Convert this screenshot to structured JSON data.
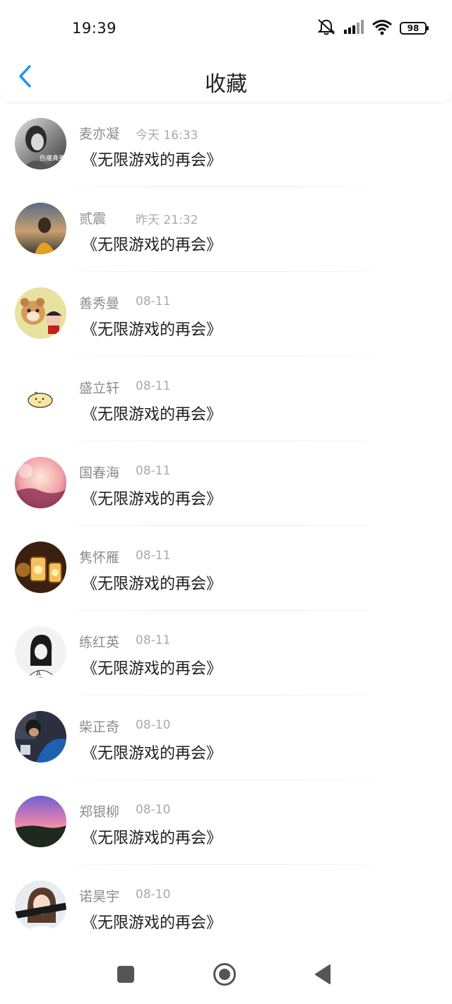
{
  "status_bar": {
    "time": "19:39",
    "icons": [
      "mute-bell-icon",
      "signal-icon",
      "wifi-icon"
    ],
    "battery_level": "98"
  },
  "nav": {
    "back_icon": "chevron-left-icon",
    "title": "收藏",
    "accent_color": "#2196F3"
  },
  "items": [
    {
      "name": "麦亦凝",
      "time": "今天 16:33",
      "title": "《无限游戏的再会》",
      "avatar_icon": "girl-photo-avatar",
      "avatar_text": "伤痛真美"
    },
    {
      "name": "贰震",
      "time": "昨天 21:32",
      "title": "《无限游戏的再会》",
      "avatar_icon": "sunset-girl-avatar"
    },
    {
      "name": "善秀曼",
      "time": "08-11",
      "title": "《无限游戏的再会》",
      "avatar_icon": "cartoon-hamster-avatar"
    },
    {
      "name": "盛立轩",
      "time": "08-11",
      "title": "《无限游戏的再会》",
      "avatar_icon": "cute-doodle-avatar"
    },
    {
      "name": "国春海",
      "time": "08-11",
      "title": "《无限游戏的再会》",
      "avatar_icon": "pink-landscape-avatar"
    },
    {
      "name": "隽怀雁",
      "time": "08-11",
      "title": "《无限游戏的再会》",
      "avatar_icon": "lanterns-avatar"
    },
    {
      "name": "练红英",
      "time": "08-11",
      "title": "《无限游戏的再会》",
      "avatar_icon": "sketch-girl-avatar"
    },
    {
      "name": "柴正奇",
      "time": "08-10",
      "title": "《无限游戏的再会》",
      "avatar_icon": "boy-photo-avatar"
    },
    {
      "name": "郑银柳",
      "time": "08-10",
      "title": "《无限游戏的再会》",
      "avatar_icon": "dusk-sky-avatar"
    },
    {
      "name": "诺昊宇",
      "time": "08-10",
      "title": "《无限游戏的再会》",
      "avatar_icon": "anime-girl-avatar"
    }
  ],
  "system_nav": {
    "recents_icon": "square-icon",
    "home_icon": "circle-home-icon",
    "back_icon": "triangle-back-icon"
  }
}
